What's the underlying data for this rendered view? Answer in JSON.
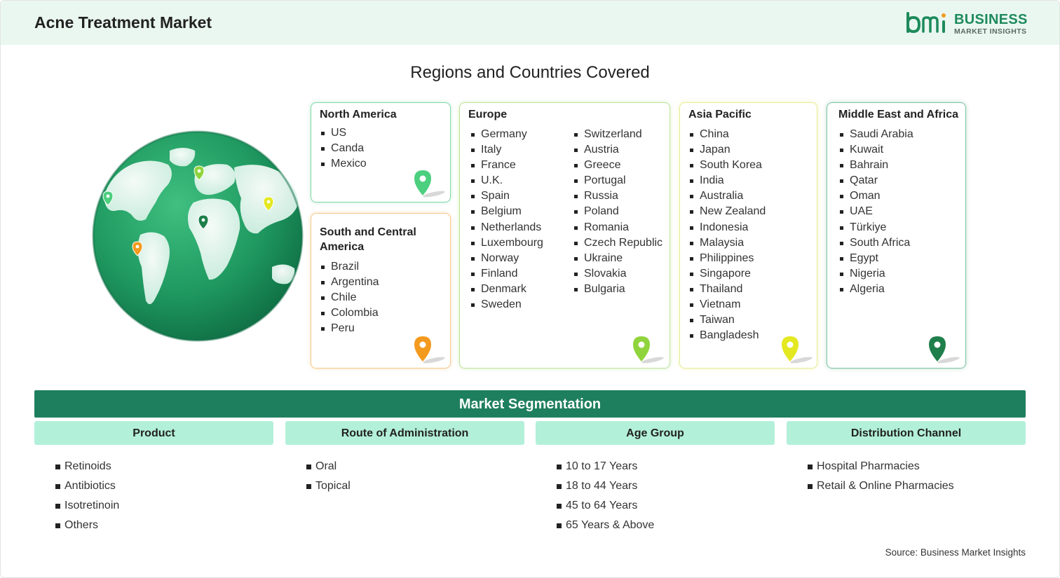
{
  "header": {
    "title": "Acne Treatment Market"
  },
  "logo": {
    "line1": "BUSINESS",
    "line2": "MARKET INSIGHTS",
    "mark_color": "#1e8a5c"
  },
  "regions_title": "Regions and Countries Covered",
  "regions": [
    {
      "name": "North America",
      "pin_color": "#4ccf7e",
      "countries": [
        "US",
        "Canda",
        "Mexico"
      ]
    },
    {
      "name": "South and Central America",
      "pin_color": "#f39a1e",
      "countries": [
        "Brazil",
        "Argentina",
        "Chile",
        "Colombia",
        "Peru"
      ]
    },
    {
      "name": "Europe",
      "pin_color": "#8fd43c",
      "countries_col1": [
        "Germany",
        "Italy",
        "France",
        "U.K.",
        "Spain",
        "Belgium",
        "Netherlands",
        "Luxembourg",
        "Norway",
        "Finland",
        "Denmark",
        "Sweden"
      ],
      "countries_col2": [
        "Switzerland",
        "Austria",
        "Greece",
        "Portugal",
        "Russia",
        "Poland",
        "Romania",
        "Czech Republic",
        "Ukraine",
        "Slovakia",
        "Bulgaria"
      ]
    },
    {
      "name": "Asia Pacific",
      "pin_color": "#e4e820",
      "countries": [
        "China",
        "Japan",
        "South Korea",
        "India",
        "Australia",
        "New Zealand",
        "Indonesia",
        "Malaysia",
        "Philippines",
        "Singapore",
        "Thailand",
        "Vietnam",
        "Taiwan",
        "Bangladesh"
      ]
    },
    {
      "name": "Middle East and Africa",
      "pin_color": "#1e7f4a",
      "countries": [
        "Saudi Arabia",
        "Kuwait",
        "Bahrain",
        "Qatar",
        "Oman",
        "UAE",
        "Türkiye",
        "South Africa",
        "Egypt",
        "Nigeria",
        "Algeria"
      ]
    }
  ],
  "segmentation": {
    "title": "Market Segmentation",
    "columns": [
      {
        "header": "Product",
        "items": [
          "Retinoids",
          "Antibiotics",
          "Isotretinoin",
          "Others"
        ]
      },
      {
        "header": "Route of Administration",
        "items": [
          "Oral",
          "Topical"
        ]
      },
      {
        "header": "Age Group",
        "items": [
          "10 to 17 Years",
          "18 to 44 Years",
          "45 to 64 Years",
          "65 Years & Above"
        ]
      },
      {
        "header": "Distribution Channel",
        "items": [
          "Hospital Pharmacies",
          "Retail & Online Pharmacies"
        ]
      }
    ]
  },
  "source": "Source: Business Market Insights",
  "colors": {
    "accent": "#1e7f5e",
    "segment_header_bg": "#b3f0da",
    "header_bg": "#eaf7f1"
  }
}
